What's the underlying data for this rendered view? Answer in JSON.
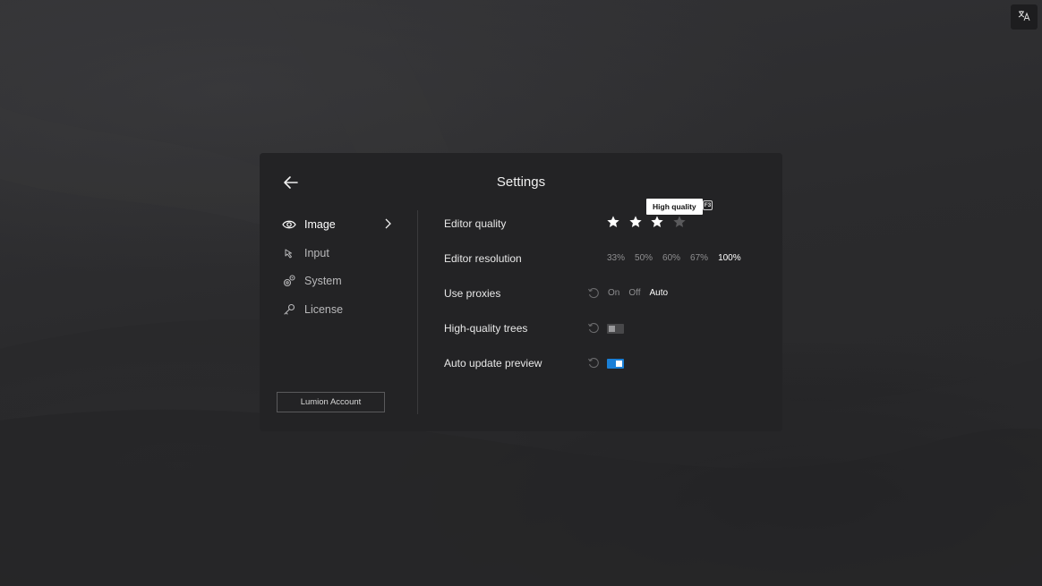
{
  "settings": {
    "title": "Settings",
    "nav": [
      {
        "label": "Image",
        "icon": "eye-icon",
        "active": true
      },
      {
        "label": "Input",
        "icon": "cursor-icon",
        "active": false
      },
      {
        "label": "System",
        "icon": "gears-icon",
        "active": false
      },
      {
        "label": "License",
        "icon": "key-icon",
        "active": false
      }
    ],
    "account_button": "Lumion Account",
    "rows": {
      "editor_quality": {
        "label": "Editor quality",
        "stars_total": 4,
        "stars_filled": 3,
        "tooltip": "High quality",
        "shortcut": "F3"
      },
      "editor_resolution": {
        "label": "Editor resolution",
        "options": [
          "33%",
          "50%",
          "60%",
          "67%",
          "100%"
        ],
        "selected": "100%"
      },
      "use_proxies": {
        "label": "Use proxies",
        "options": [
          "On",
          "Off",
          "Auto"
        ],
        "selected": "Auto"
      },
      "high_quality_trees": {
        "label": "High-quality trees",
        "enabled": false
      },
      "auto_update_preview": {
        "label": "Auto update preview",
        "enabled": true
      }
    }
  },
  "colors": {
    "accent": "#1a7fd6",
    "panel": "#232325",
    "background": "#2e2e30"
  },
  "icons": {
    "language": "translate-icon",
    "back": "arrow-left-icon",
    "chevron": "chevron-right-icon",
    "reset": "reset-icon"
  }
}
